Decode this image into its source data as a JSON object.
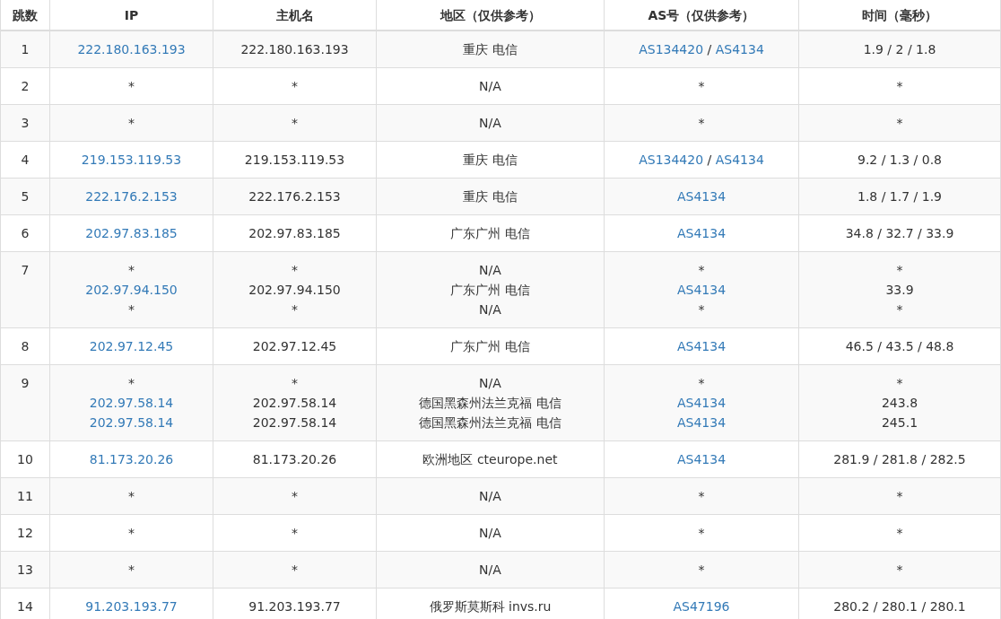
{
  "table": {
    "columns": [
      "跳数",
      "IP",
      "主机名",
      "地区（仅供参考）",
      "AS号（仅供参考）",
      "时间（毫秒）"
    ],
    "rows": [
      {
        "hop": "1",
        "ip": [
          {
            "text": "222.180.163.193",
            "link": true
          }
        ],
        "hostname": [
          "222.180.163.193"
        ],
        "region": [
          "重庆 电信"
        ],
        "as": [
          [
            {
              "text": "AS134420",
              "link": true
            },
            {
              "text": " / ",
              "link": false
            },
            {
              "text": "AS4134",
              "link": true
            }
          ]
        ],
        "time": [
          "1.9 / 2 / 1.8"
        ]
      },
      {
        "hop": "2",
        "ip": [
          {
            "text": "*",
            "link": false
          }
        ],
        "hostname": [
          "*"
        ],
        "region": [
          "N/A"
        ],
        "as": [
          [
            {
              "text": "*",
              "link": false
            }
          ]
        ],
        "time": [
          "*"
        ]
      },
      {
        "hop": "3",
        "ip": [
          {
            "text": "*",
            "link": false
          }
        ],
        "hostname": [
          "*"
        ],
        "region": [
          "N/A"
        ],
        "as": [
          [
            {
              "text": "*",
              "link": false
            }
          ]
        ],
        "time": [
          "*"
        ]
      },
      {
        "hop": "4",
        "ip": [
          {
            "text": "219.153.119.53",
            "link": true
          }
        ],
        "hostname": [
          "219.153.119.53"
        ],
        "region": [
          "重庆 电信"
        ],
        "as": [
          [
            {
              "text": "AS134420",
              "link": true
            },
            {
              "text": " / ",
              "link": false
            },
            {
              "text": "AS4134",
              "link": true
            }
          ]
        ],
        "time": [
          "9.2 / 1.3 / 0.8"
        ]
      },
      {
        "hop": "5",
        "ip": [
          {
            "text": "222.176.2.153",
            "link": true
          }
        ],
        "hostname": [
          "222.176.2.153"
        ],
        "region": [
          "重庆 电信"
        ],
        "as": [
          [
            {
              "text": "AS4134",
              "link": true
            }
          ]
        ],
        "time": [
          "1.8 / 1.7 / 1.9"
        ]
      },
      {
        "hop": "6",
        "ip": [
          {
            "text": "202.97.83.185",
            "link": true
          }
        ],
        "hostname": [
          "202.97.83.185"
        ],
        "region": [
          "广东广州 电信"
        ],
        "as": [
          [
            {
              "text": "AS4134",
              "link": true
            }
          ]
        ],
        "time": [
          "34.8 / 32.7 / 33.9"
        ]
      },
      {
        "hop": "7",
        "ip": [
          {
            "text": "*",
            "link": false
          },
          {
            "text": "202.97.94.150",
            "link": true
          },
          {
            "text": "*",
            "link": false
          }
        ],
        "hostname": [
          "*",
          "202.97.94.150",
          "*"
        ],
        "region": [
          "N/A",
          "广东广州 电信",
          "N/A"
        ],
        "as": [
          [
            {
              "text": "*",
              "link": false
            }
          ],
          [
            {
              "text": "AS4134",
              "link": true
            }
          ],
          [
            {
              "text": "*",
              "link": false
            }
          ]
        ],
        "time": [
          "*",
          "33.9",
          "*"
        ]
      },
      {
        "hop": "8",
        "ip": [
          {
            "text": "202.97.12.45",
            "link": true
          }
        ],
        "hostname": [
          "202.97.12.45"
        ],
        "region": [
          "广东广州 电信"
        ],
        "as": [
          [
            {
              "text": "AS4134",
              "link": true
            }
          ]
        ],
        "time": [
          "46.5 / 43.5 / 48.8"
        ]
      },
      {
        "hop": "9",
        "ip": [
          {
            "text": "*",
            "link": false
          },
          {
            "text": "202.97.58.14",
            "link": true
          },
          {
            "text": "202.97.58.14",
            "link": true
          }
        ],
        "hostname": [
          "*",
          "202.97.58.14",
          "202.97.58.14"
        ],
        "region": [
          "N/A",
          "德国黑森州法兰克福 电信",
          "德国黑森州法兰克福 电信"
        ],
        "as": [
          [
            {
              "text": "*",
              "link": false
            }
          ],
          [
            {
              "text": "AS4134",
              "link": true
            }
          ],
          [
            {
              "text": "AS4134",
              "link": true
            }
          ]
        ],
        "time": [
          "*",
          "243.8",
          "245.1"
        ]
      },
      {
        "hop": "10",
        "ip": [
          {
            "text": "81.173.20.26",
            "link": true
          }
        ],
        "hostname": [
          "81.173.20.26"
        ],
        "region": [
          "欧洲地区 cteurope.net"
        ],
        "as": [
          [
            {
              "text": "AS4134",
              "link": true
            }
          ]
        ],
        "time": [
          "281.9 / 281.8 / 282.5"
        ]
      },
      {
        "hop": "11",
        "ip": [
          {
            "text": "*",
            "link": false
          }
        ],
        "hostname": [
          "*"
        ],
        "region": [
          "N/A"
        ],
        "as": [
          [
            {
              "text": "*",
              "link": false
            }
          ]
        ],
        "time": [
          "*"
        ]
      },
      {
        "hop": "12",
        "ip": [
          {
            "text": "*",
            "link": false
          }
        ],
        "hostname": [
          "*"
        ],
        "region": [
          "N/A"
        ],
        "as": [
          [
            {
              "text": "*",
              "link": false
            }
          ]
        ],
        "time": [
          "*"
        ]
      },
      {
        "hop": "13",
        "ip": [
          {
            "text": "*",
            "link": false
          }
        ],
        "hostname": [
          "*"
        ],
        "region": [
          "N/A"
        ],
        "as": [
          [
            {
              "text": "*",
              "link": false
            }
          ]
        ],
        "time": [
          "*"
        ]
      },
      {
        "hop": "14",
        "ip": [
          {
            "text": "91.203.193.77",
            "link": true
          }
        ],
        "hostname": [
          "91.203.193.77"
        ],
        "region": [
          "俄罗斯莫斯科 invs.ru"
        ],
        "as": [
          [
            {
              "text": "AS47196",
              "link": true
            }
          ]
        ],
        "time": [
          "280.2 / 280.1 / 280.1"
        ]
      }
    ]
  }
}
